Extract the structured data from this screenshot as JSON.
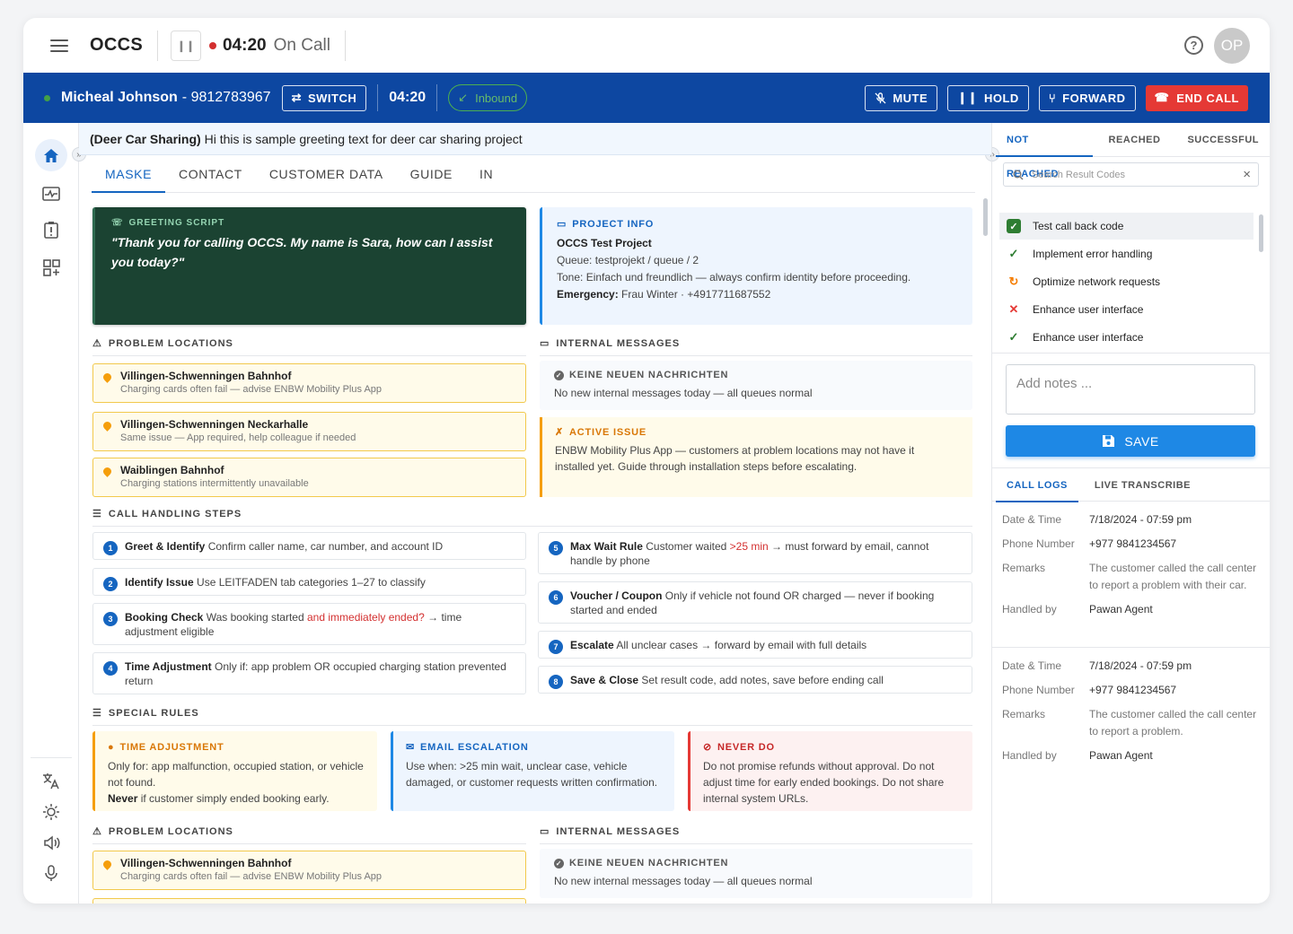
{
  "topbar": {
    "app_name": "OCCS",
    "timer": "04:20",
    "status": "On Call",
    "avatar_initials": "OP"
  },
  "callbar": {
    "caller_name": "Micheal Johnson",
    "caller_phone": "- 9812783967",
    "switch_label": "SWITCH",
    "call_timer": "04:20",
    "direction": "Inbound",
    "mute_label": "MUTE",
    "hold_label": "HOLD",
    "forward_label": "FORWARD",
    "end_label": "END CALL"
  },
  "greeting": {
    "project": "(Deer Car Sharing)",
    "text": "Hi this is sample greeting text for deer car sharing project"
  },
  "tabs": [
    "MASKE",
    "CONTACT",
    "CUSTOMER DATA",
    "GUIDE",
    "IN"
  ],
  "greeting_script": {
    "label": "GREETING SCRIPT",
    "text": "\"Thank you for calling OCCS. My name is Sara, how can I assist you today?\""
  },
  "project_info": {
    "label": "PROJECT INFO",
    "title": "OCCS Test Project",
    "queue": "Queue: testprojekt / queue / 2",
    "tone": "Tone: Einfach und freundlich — always confirm identity before proceeding.",
    "emergency_label": "Emergency:",
    "emergency_value": "Frau Winter · +4917711687552"
  },
  "sections": {
    "problem_locations": "PROBLEM LOCATIONS",
    "internal_messages": "INTERNAL MESSAGES",
    "call_steps": "CALL HANDLING STEPS",
    "special_rules": "SPECIAL RULES"
  },
  "locations": [
    {
      "title": "Villingen-Schwenningen Bahnhof",
      "sub": "Charging cards often fail — advise ENBW Mobility Plus App"
    },
    {
      "title": "Villingen-Schwenningen Neckarhalle",
      "sub": "Same issue — App required, help colleague if needed"
    },
    {
      "title": "Waiblingen Bahnhof",
      "sub": "Charging stations intermittently unavailable"
    }
  ],
  "internal": {
    "title": "KEINE NEUEN NACHRICHTEN",
    "text": "No new internal messages today — all queues normal"
  },
  "active_issue": {
    "label": "ACTIVE ISSUE",
    "text": "ENBW Mobility Plus App — customers at problem locations may not have it installed yet. Guide through installation steps before escalating."
  },
  "steps": [
    {
      "n": "1",
      "title": "Greet & Identify",
      "text": "Confirm caller name, car number, and account ID"
    },
    {
      "n": "2",
      "title": "Identify Issue",
      "text": "Use LEITFADEN tab categories 1–27 to classify"
    },
    {
      "n": "3",
      "title": "Booking Check",
      "pre": "Was booking started",
      "red": "and immediately ended?",
      "post": "→ time adjustment eligible"
    },
    {
      "n": "4",
      "title": "Time Adjustment",
      "text": "Only if: app problem OR occupied charging station prevented return"
    },
    {
      "n": "5",
      "title": "Max Wait Rule",
      "pre": "Customer waited",
      "red": ">25 min",
      "post": "→ must forward by email, cannot handle by phone"
    },
    {
      "n": "6",
      "title": "Voucher / Coupon",
      "text": "Only if vehicle not found OR charged — never if booking started and ended"
    },
    {
      "n": "7",
      "title": "Escalate",
      "text": "All unclear cases → forward by email with full details"
    },
    {
      "n": "8",
      "title": "Save & Close",
      "text": "Set result code, add notes, save before ending call"
    }
  ],
  "rules": [
    {
      "label": "TIME ADJUSTMENT",
      "text": "Only for: app malfunction, occupied station, or vehicle not found.",
      "bold": "Never",
      "text2": "if customer simply ended booking early."
    },
    {
      "label": "EMAIL ESCALATION",
      "text": "Use when: >25 min wait, unclear case, vehicle damaged, or customer requests written confirmation."
    },
    {
      "label": "NEVER DO",
      "text": "Do not promise refunds without approval. Do not adjust time for early ended bookings. Do not share internal system URLs."
    }
  ],
  "colors": {
    "primary": "#0d47a1",
    "accent": "#1565c0",
    "end_call": "#e53935",
    "script_bg": "#1b4332",
    "warn": "#f59e0b"
  },
  "right": {
    "tabs": [
      "NOT REACHED",
      "REACHED",
      "SUCCESSFUL"
    ],
    "search_placeholder": "Search Result Codes",
    "codes": [
      {
        "label": "Test call back code",
        "icon": "checkbox-checked"
      },
      {
        "label": "Implement error handling",
        "icon": "check"
      },
      {
        "label": "Optimize network requests",
        "icon": "refresh"
      },
      {
        "label": "Enhance user interface",
        "icon": "cross"
      },
      {
        "label": "Enhance user interface",
        "icon": "check"
      }
    ],
    "notes_placeholder": "Add notes ...",
    "save_label": "SAVE",
    "log_tabs": [
      "CALL LOGS",
      "LIVE TRANSCRIBE"
    ],
    "log_keys": {
      "date": "Date & Time",
      "phone": "Phone Number",
      "remarks": "Remarks",
      "handled": "Handled by"
    },
    "logs": [
      {
        "date": "7/18/2024 - 07:59 pm",
        "phone": "+977 9841234567",
        "remarks": "The customer called the call center to report a problem with their car.",
        "handled": "Pawan Agent"
      },
      {
        "date": "7/18/2024 - 07:59 pm",
        "phone": "+977 9841234567",
        "remarks": "The customer called the call center to report a problem.",
        "handled": "Pawan Agent"
      }
    ]
  }
}
